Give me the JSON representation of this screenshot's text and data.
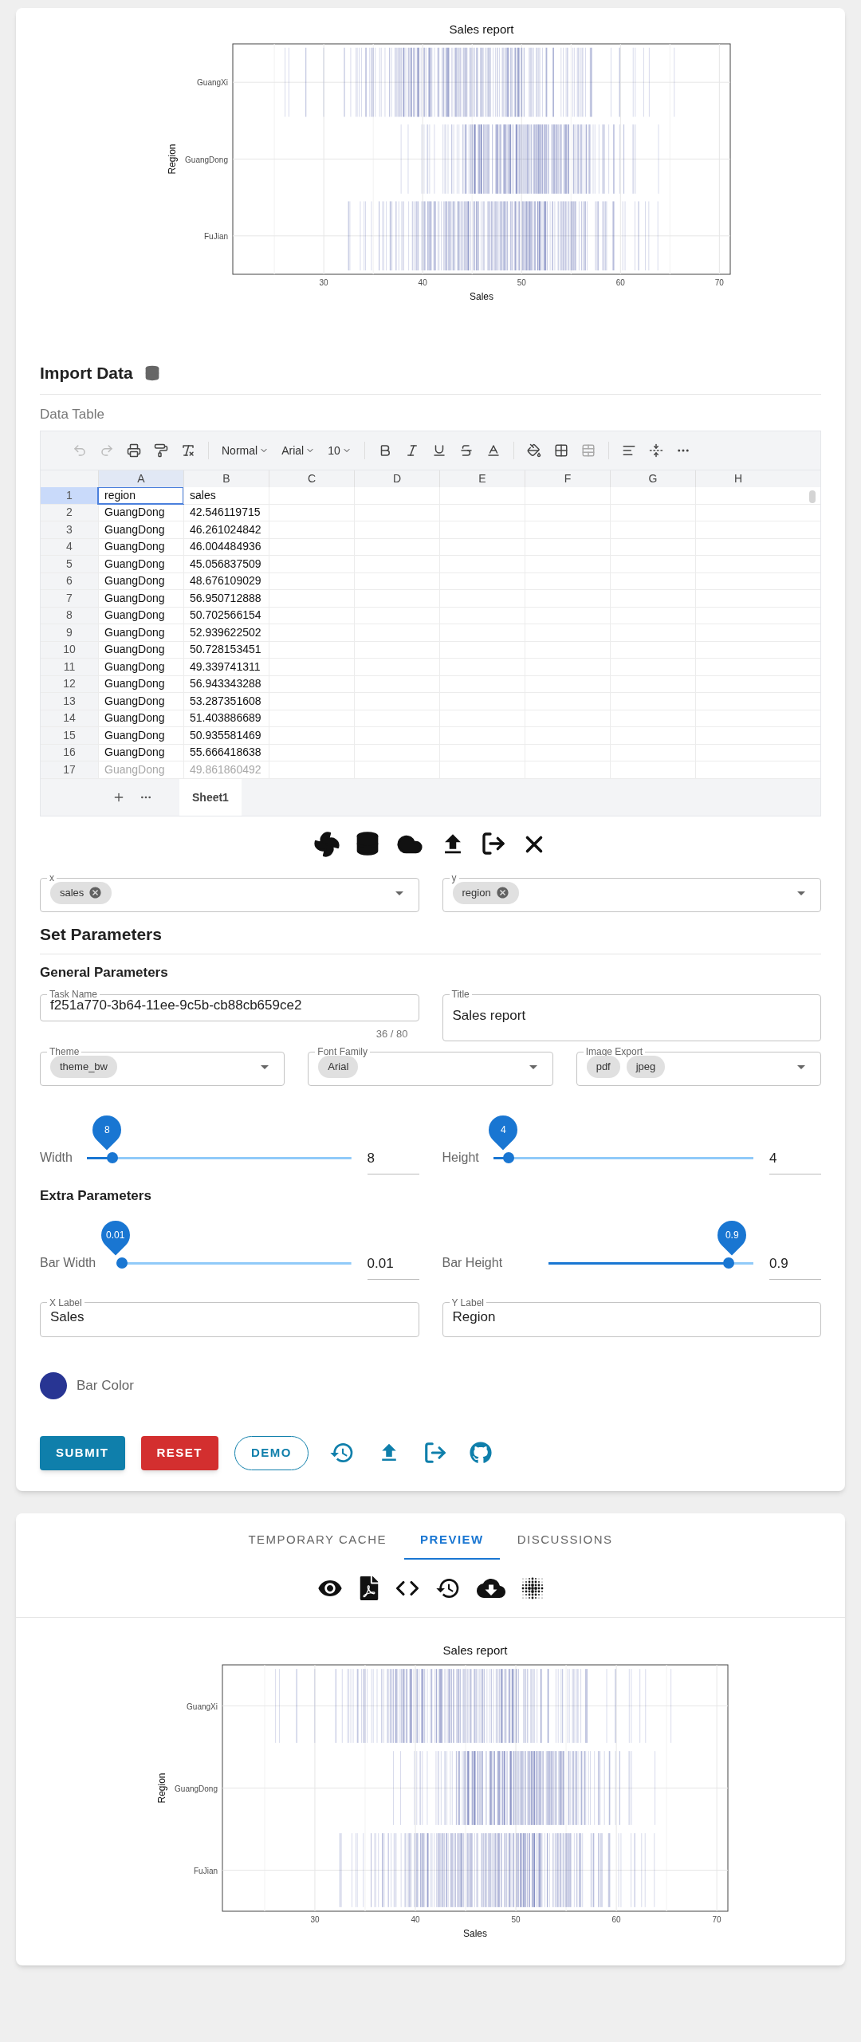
{
  "top_plot": {
    "title": "Sales report",
    "xlabel": "Sales",
    "ylabel": "Region",
    "categories": [
      "GuangXi",
      "GuangDong",
      "FuJian"
    ],
    "xticks": [
      "30",
      "40",
      "50",
      "60",
      "70"
    ]
  },
  "import_data": {
    "title": "Import Data",
    "subtitle": "Data Table"
  },
  "sheet": {
    "toolbar": {
      "style": "Normal",
      "font": "Arial",
      "size": "10"
    },
    "columns": [
      {
        "label": "A",
        "selected": true
      },
      {
        "label": "B",
        "selected": false
      },
      {
        "label": "C",
        "selected": false
      },
      {
        "label": "D",
        "selected": false
      },
      {
        "label": "E",
        "selected": false
      },
      {
        "label": "F",
        "selected": false
      },
      {
        "label": "G",
        "selected": false
      },
      {
        "label": "H",
        "selected": false
      }
    ],
    "rows": [
      {
        "number": "1",
        "selected": true,
        "faded": false,
        "cells": [
          "region",
          "sales"
        ]
      },
      {
        "number": "2",
        "selected": false,
        "faded": false,
        "cells": [
          "GuangDong",
          "42.546119715"
        ]
      },
      {
        "number": "3",
        "selected": false,
        "faded": false,
        "cells": [
          "GuangDong",
          "46.261024842"
        ]
      },
      {
        "number": "4",
        "selected": false,
        "faded": false,
        "cells": [
          "GuangDong",
          "46.004484936"
        ]
      },
      {
        "number": "5",
        "selected": false,
        "faded": false,
        "cells": [
          "GuangDong",
          "45.056837509"
        ]
      },
      {
        "number": "6",
        "selected": false,
        "faded": false,
        "cells": [
          "GuangDong",
          "48.676109029"
        ]
      },
      {
        "number": "7",
        "selected": false,
        "faded": false,
        "cells": [
          "GuangDong",
          "56.950712888"
        ]
      },
      {
        "number": "8",
        "selected": false,
        "faded": false,
        "cells": [
          "GuangDong",
          "50.702566154"
        ]
      },
      {
        "number": "9",
        "selected": false,
        "faded": false,
        "cells": [
          "GuangDong",
          "52.939622502"
        ]
      },
      {
        "number": "10",
        "selected": false,
        "faded": false,
        "cells": [
          "GuangDong",
          "50.728153451"
        ]
      },
      {
        "number": "11",
        "selected": false,
        "faded": false,
        "cells": [
          "GuangDong",
          "49.339741311"
        ]
      },
      {
        "number": "12",
        "selected": false,
        "faded": false,
        "cells": [
          "GuangDong",
          "56.943343288"
        ]
      },
      {
        "number": "13",
        "selected": false,
        "faded": false,
        "cells": [
          "GuangDong",
          "53.287351608"
        ]
      },
      {
        "number": "14",
        "selected": false,
        "faded": false,
        "cells": [
          "GuangDong",
          "51.403886689"
        ]
      },
      {
        "number": "15",
        "selected": false,
        "faded": false,
        "cells": [
          "GuangDong",
          "50.935581469"
        ]
      },
      {
        "number": "16",
        "selected": false,
        "faded": false,
        "cells": [
          "GuangDong",
          "55.666418638"
        ]
      },
      {
        "number": "17",
        "selected": false,
        "faded": true,
        "cells": [
          "GuangDong",
          "49.861860492"
        ]
      }
    ],
    "sheet_tabs": [
      {
        "label": "Sheet1",
        "selected": true
      }
    ]
  },
  "axis_selects": [
    {
      "label": "x",
      "chips": [
        "sales"
      ]
    },
    {
      "label": "y",
      "chips": [
        "region"
      ]
    }
  ],
  "set_parameters": {
    "title": "Set Parameters",
    "general_title": "General Parameters",
    "task_name": {
      "label": "Task Name",
      "value": "f251a770-3b64-11ee-9c5b-cb88cb659ce2",
      "counter": "36 / 80"
    },
    "title_field": {
      "label": "Title",
      "value": "Sales report"
    },
    "selects": [
      {
        "label": "Theme",
        "chips": [
          "theme_bw"
        ]
      },
      {
        "label": "Font Family",
        "chips": [
          "Arial"
        ]
      },
      {
        "label": "Image Export",
        "chips": [
          "pdf",
          "jpeg"
        ]
      }
    ],
    "size_sliders": [
      {
        "label": "Width",
        "level": 0.08,
        "bubble": "8",
        "value": "8"
      },
      {
        "label": "Height",
        "level": 0.04,
        "bubble": "4",
        "value": "4"
      }
    ],
    "extra_title": "Extra Parameters",
    "extra_sliders": [
      {
        "label": "Bar Width",
        "level": 0,
        "bubble": "0.01",
        "value": "0.01"
      },
      {
        "label": "Bar Height",
        "level": 0.9,
        "bubble": "0.9",
        "value": "0.9"
      }
    ],
    "label_fields": [
      {
        "label": "X Label",
        "value": "Sales"
      },
      {
        "label": "Y Label",
        "value": "Region"
      }
    ],
    "bar_color": {
      "label": "Bar Color",
      "color": "#283593"
    }
  },
  "buttons": [
    {
      "label": "SUBMIT",
      "kind": "primary"
    },
    {
      "label": "RESET",
      "kind": "danger"
    },
    {
      "label": "DEMO",
      "kind": "outlined"
    }
  ],
  "preview": {
    "tabs": [
      {
        "label": "TEMPORARY CACHE",
        "selected": false
      },
      {
        "label": "PREVIEW",
        "selected": true
      },
      {
        "label": "DISCUSSIONS",
        "selected": false
      }
    ],
    "plot": {
      "title": "Sales report",
      "xlabel": "Sales",
      "ylabel": "Region",
      "categories": [
        "GuangXi",
        "GuangDong",
        "FuJian"
      ],
      "xticks": [
        "30",
        "40",
        "50",
        "60",
        "70"
      ]
    }
  }
}
